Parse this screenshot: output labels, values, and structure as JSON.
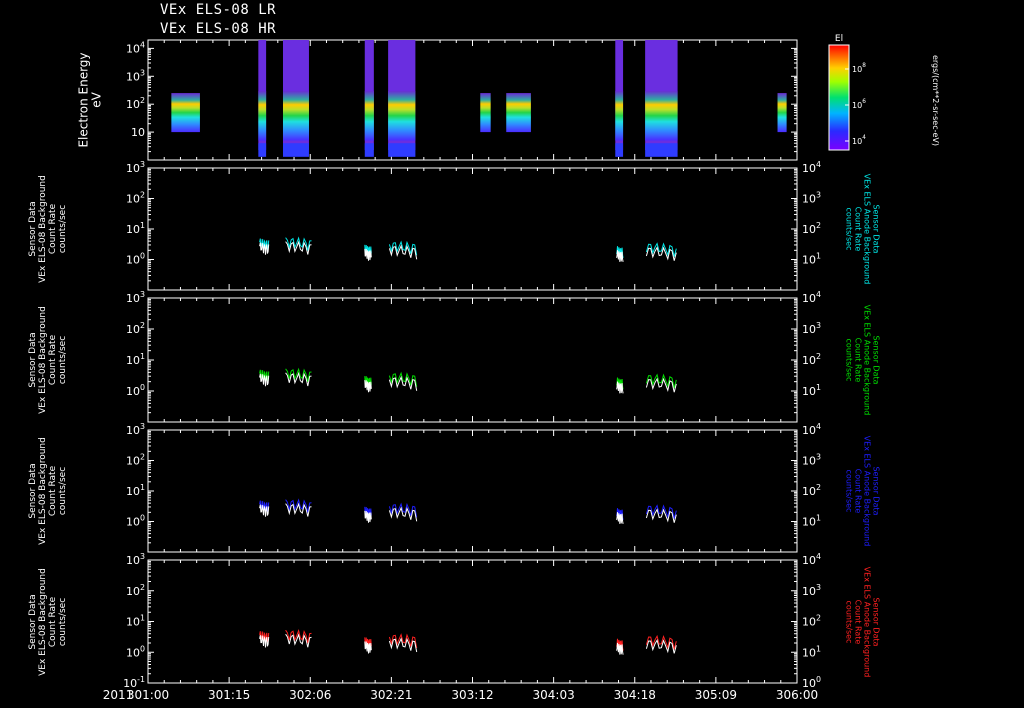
{
  "titles": [
    "VEx ELS-08 LR",
    "VEx ELS-08 HR"
  ],
  "year_label": "2011",
  "colorbar": {
    "label": "El",
    "units": "ergs/(cm**2-sr-sec-eV)",
    "tick_labels": [
      "10^4",
      "10^6",
      "10^8"
    ]
  },
  "panels": [
    {
      "id": "spectrogram",
      "ylabel_lines": [
        "Electron Energy",
        "eV"
      ],
      "ytick_labels": [
        "10",
        "10^2",
        "10^3",
        "10^4"
      ]
    },
    {
      "id": "cyan",
      "color": "#00e5e5",
      "ylabel_left": [
        "Sensor Data",
        "VEx ELS-08 Background",
        "Count Rate",
        "counts/sec"
      ],
      "ylabel_right": [
        "Sensor Data",
        "VEx ELS Anode Background",
        "Count Rate",
        "counts/sec"
      ],
      "left_ticks": [
        "10^-1",
        "10^0",
        "10^1",
        "10^2",
        "10^3"
      ],
      "right_ticks": [
        "10^1",
        "10^2",
        "10^3",
        "10^4"
      ]
    },
    {
      "id": "green",
      "color": "#00dd00",
      "ylabel_left": [
        "Sensor Data",
        "VEx ELS-08 Background",
        "Count Rate",
        "counts/sec"
      ],
      "ylabel_right": [
        "Sensor Data",
        "VEx ELS Anode Background",
        "Count Rate",
        "counts/sec"
      ],
      "left_ticks": [
        "10^-1",
        "10^0",
        "10^1",
        "10^2",
        "10^3"
      ],
      "right_ticks": [
        "10^1",
        "10^2",
        "10^3",
        "10^4"
      ]
    },
    {
      "id": "blue",
      "color": "#1e1eff",
      "ylabel_left": [
        "Sensor Data",
        "VEx ELS-08 Background",
        "Count Rate",
        "counts/sec"
      ],
      "ylabel_right": [
        "Sensor Data",
        "VEx ELS Anode Background",
        "Count Rate",
        "counts/sec"
      ],
      "left_ticks": [
        "10^-1",
        "10^0",
        "10^1",
        "10^2",
        "10^3"
      ],
      "right_ticks": [
        "10^1",
        "10^2",
        "10^3",
        "10^4"
      ]
    },
    {
      "id": "red",
      "color": "#ff2020",
      "ylabel_left": [
        "Sensor Data",
        "VEx ELS-08 Background",
        "Count Rate",
        "counts/sec"
      ],
      "ylabel_right": [
        "Sensor Data",
        "VEx ELS Anode Background",
        "Count Rate",
        "counts/sec"
      ],
      "left_ticks": [
        "10^-1",
        "10^0",
        "10^1",
        "10^2",
        "10^3"
      ],
      "right_ticks": [
        "10^0",
        "10^1",
        "10^2",
        "10^3",
        "10^4"
      ]
    }
  ],
  "chart_data": {
    "type": "heatmap",
    "x_tick_labels": [
      "301:00",
      "301:15",
      "302:06",
      "302:21",
      "303:12",
      "304:03",
      "304:18",
      "305:09",
      "306:00"
    ],
    "x_unit": "day:hour of 2011",
    "x_range": [
      "301:00",
      "306:00"
    ],
    "spectrogram": {
      "yscale": "log",
      "ylim": [
        1,
        20000
      ],
      "intervals": [
        {
          "start": 0.18,
          "end": 0.4,
          "emin": 10,
          "emax": 250
        },
        {
          "start": 0.85,
          "end": 0.91,
          "emin": 1,
          "emax": 30000
        },
        {
          "start": 1.04,
          "end": 1.24,
          "emin": 1,
          "emax": 30000
        },
        {
          "start": 1.67,
          "end": 1.74,
          "emin": 1,
          "emax": 30000
        },
        {
          "start": 1.85,
          "end": 2.06,
          "emin": 1,
          "emax": 30000
        },
        {
          "start": 2.56,
          "end": 2.64,
          "emin": 10,
          "emax": 250
        },
        {
          "start": 2.76,
          "end": 2.95,
          "emin": 10,
          "emax": 250
        },
        {
          "start": 3.6,
          "end": 3.66,
          "emin": 1,
          "emax": 30000
        },
        {
          "start": 3.83,
          "end": 4.08,
          "emin": 1,
          "emax": 30000
        },
        {
          "start": 4.85,
          "end": 4.92,
          "emin": 10,
          "emax": 250
        }
      ]
    },
    "count_rate": {
      "yscale": "log",
      "ylim_left": [
        0.1,
        1000
      ],
      "ylim_right": [
        1,
        10000
      ],
      "segments": [
        {
          "start": 0.86,
          "end": 0.93,
          "level": 3.2
        },
        {
          "start": 1.06,
          "end": 1.26,
          "level": 3.5
        },
        {
          "start": 1.67,
          "end": 1.72,
          "level": 2.0
        },
        {
          "start": 1.86,
          "end": 2.07,
          "level": 2.6
        },
        {
          "start": 3.61,
          "end": 3.66,
          "level": 1.8
        },
        {
          "start": 3.84,
          "end": 4.07,
          "level": 2.3
        }
      ]
    }
  }
}
